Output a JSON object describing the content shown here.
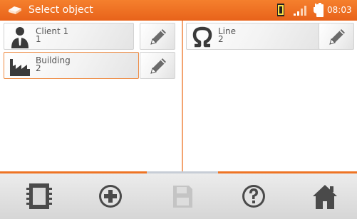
{
  "header": {
    "title": "Select object",
    "time": "08:03",
    "bar_color": "#ee7424"
  },
  "left_panel": {
    "items": [
      {
        "label": "Client 1",
        "number": "1",
        "icon": "person-icon",
        "selected": false
      },
      {
        "label": "Building",
        "number": "2",
        "icon": "factory-icon",
        "selected": true
      }
    ]
  },
  "right_panel": {
    "items": [
      {
        "label": "Line",
        "number": "2",
        "icon": "omega-icon",
        "selected": false
      }
    ]
  },
  "toolbar": {
    "buttons": [
      "memory-card-icon",
      "add-icon",
      "save-icon",
      "help-icon",
      "home-icon"
    ],
    "save_enabled": false
  },
  "status_icons": [
    "memory-icon",
    "signal-icon",
    "plug-icon",
    "battery-icon"
  ]
}
